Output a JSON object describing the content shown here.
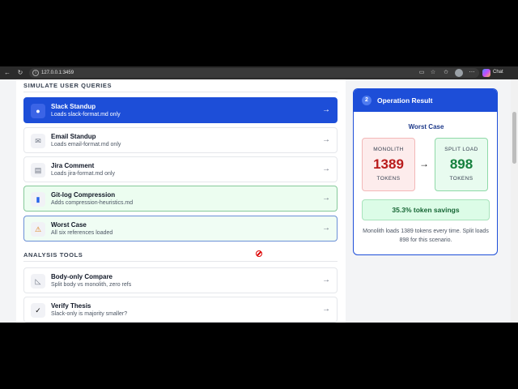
{
  "browser": {
    "url": "127.0.0.1:3459",
    "chat_label": "Chat"
  },
  "simulate": {
    "heading": "SIMULATE USER QUERIES",
    "items": [
      {
        "title": "Slack Standup",
        "subtitle": "Loads slack-format.md only",
        "icon": "chat-bubble-icon",
        "glyph": "●",
        "arrow": "→",
        "state": "active"
      },
      {
        "title": "Email Standup",
        "subtitle": "Loads email-format.md only",
        "icon": "envelope-icon",
        "glyph": "✉",
        "arrow": "→",
        "state": "default"
      },
      {
        "title": "Jira Comment",
        "subtitle": "Loads jira-format.md only",
        "icon": "clipboard-icon",
        "glyph": "▤",
        "arrow": "→",
        "state": "default"
      },
      {
        "title": "Git-log Compression",
        "subtitle": "Adds compression-heuristics.md",
        "icon": "bar-chart-icon",
        "glyph": "▮",
        "arrow": "→",
        "state": "highlight"
      },
      {
        "title": "Worst Case",
        "subtitle": "All six references loaded",
        "icon": "warning-icon",
        "glyph": "⚠",
        "arrow": "→",
        "state": "selected"
      }
    ]
  },
  "analysis": {
    "heading": "ANALYSIS TOOLS",
    "items": [
      {
        "title": "Body-only Compare",
        "subtitle": "Split body vs monolith, zero refs",
        "icon": "ruler-icon",
        "glyph": "◺",
        "arrow": "→"
      },
      {
        "title": "Verify Thesis",
        "subtitle": "Slack-only is majority smaller?",
        "icon": "checkmark-icon",
        "glyph": "✓",
        "arrow": "→"
      }
    ]
  },
  "result": {
    "step": "2",
    "title": "Operation Result",
    "scenario": "Worst Case",
    "monolith_label": "MONOLITH",
    "monolith_value": "1389",
    "split_label": "SPLIT LOAD",
    "split_value": "898",
    "unit": "TOKENS",
    "arrow": "→",
    "savings": "35.3% token savings",
    "note": "Monolith loads 1389 tokens every time. Split loads 898 for this scenario."
  },
  "colors": {
    "accent": "#1d4ed8",
    "success": "#15803d",
    "danger": "#b91c1c"
  }
}
